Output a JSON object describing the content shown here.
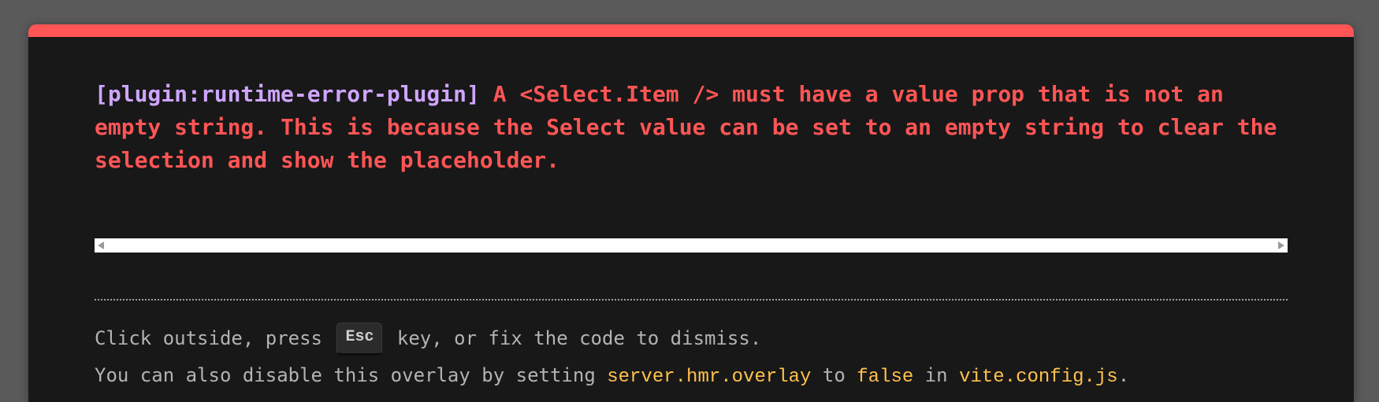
{
  "error": {
    "plugin": "[plugin:runtime-error-plugin]",
    "message": " A <Select.Item /> must have a value prop that is not an empty string. This is because the Select value can be set to an empty string to clear the selection and show the placeholder."
  },
  "tip": {
    "line1_before": "Click outside, press ",
    "esc_key": "Esc",
    "line1_after": " key, or fix the code to dismiss.",
    "line2_prefix": "You can also disable this overlay by setting ",
    "setting": "server.hmr.overlay",
    "to": " to ",
    "value": "false",
    "in": " in ",
    "file": "vite.config.js",
    "period": "."
  },
  "colors": {
    "accent": "#ff5555",
    "plugin": "#cfa5ff",
    "code": "#ffc14d",
    "background": "#181818"
  }
}
